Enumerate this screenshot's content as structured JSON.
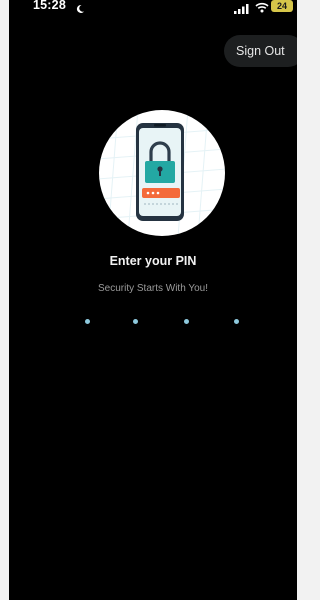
{
  "status_bar": {
    "time": "15:28",
    "battery": "24",
    "icons": [
      "moon-icon",
      "signal-icon",
      "wifi-icon",
      "battery-icon"
    ]
  },
  "header": {
    "sign_out_label": "Sign Out"
  },
  "main": {
    "illustration": "phone-lock-illustration",
    "title": "Enter your PIN",
    "subtitle": "Security Starts With You!",
    "pin_length": 4,
    "pin_entered": 0
  },
  "colors": {
    "background": "#000000",
    "pin_dot": "#8ec9dd",
    "lock_teal": "#23a8a3",
    "pin_field": "#f46a3a",
    "battery": "#d6c64a"
  }
}
